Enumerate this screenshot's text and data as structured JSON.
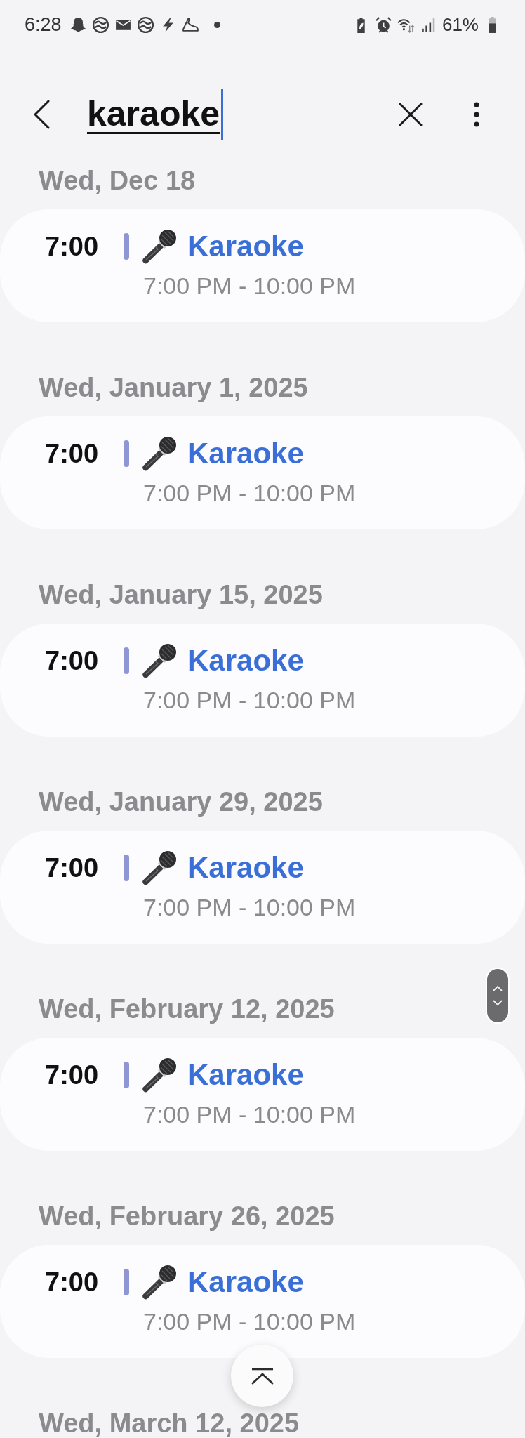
{
  "status_bar": {
    "time": "6:28",
    "battery": "61%"
  },
  "search": {
    "value": "karaoke"
  },
  "results": [
    {
      "date": "Wed, Dec 18",
      "events": [
        {
          "time": "7:00",
          "title": "Karaoke",
          "time_range": "7:00 PM - 10:00 PM",
          "color": "#8e96d4"
        }
      ]
    },
    {
      "date": "Wed, January 1, 2025",
      "events": [
        {
          "time": "7:00",
          "title": "Karaoke",
          "time_range": "7:00 PM - 10:00 PM",
          "color": "#8e96d4"
        }
      ]
    },
    {
      "date": "Wed, January 15, 2025",
      "events": [
        {
          "time": "7:00",
          "title": "Karaoke",
          "time_range": "7:00 PM - 10:00 PM",
          "color": "#8e96d4"
        }
      ]
    },
    {
      "date": "Wed, January 29, 2025",
      "events": [
        {
          "time": "7:00",
          "title": "Karaoke",
          "time_range": "7:00 PM - 10:00 PM",
          "color": "#8e96d4"
        }
      ]
    },
    {
      "date": "Wed, February 12, 2025",
      "events": [
        {
          "time": "7:00",
          "title": "Karaoke",
          "time_range": "7:00 PM - 10:00 PM",
          "color": "#8e96d4"
        }
      ]
    },
    {
      "date": "Wed, February 26, 2025",
      "events": [
        {
          "time": "7:00",
          "title": "Karaoke",
          "time_range": "7:00 PM - 10:00 PM",
          "color": "#8e96d4"
        }
      ]
    },
    {
      "date": "Wed, March 12, 2025"
    }
  ]
}
